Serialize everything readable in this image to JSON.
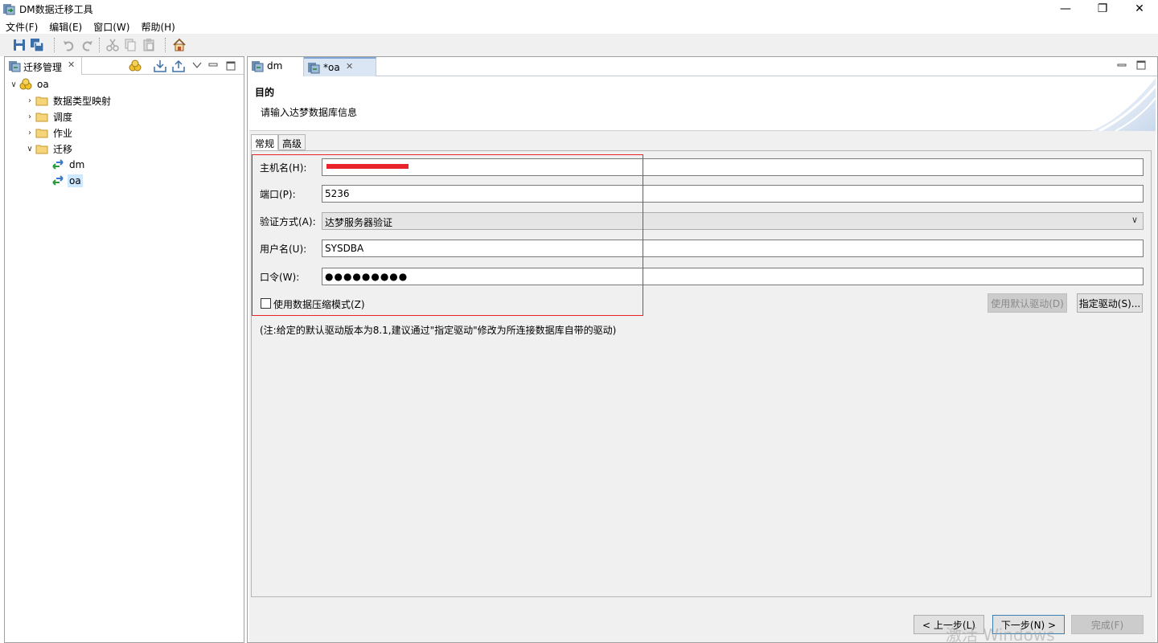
{
  "window": {
    "title": "DM数据迁移工具",
    "controls": {
      "minimize": "—",
      "maximize": "❐",
      "close": "✕"
    }
  },
  "menu": [
    {
      "label": "文件(F)"
    },
    {
      "label": "编辑(E)"
    },
    {
      "label": "窗口(W)"
    },
    {
      "label": "帮助(H)"
    }
  ],
  "left_view": {
    "tab_label": "迁移管理",
    "tree": {
      "root": "oa",
      "children": [
        "数据类型映射",
        "调度",
        "作业",
        "迁移"
      ],
      "migrations": [
        "dm",
        "oa"
      ]
    }
  },
  "editor": {
    "tabs": [
      {
        "label": "dm"
      },
      {
        "label": "*oa"
      }
    ],
    "wizard": {
      "title": "目的",
      "description": "请输入达梦数据库信息"
    },
    "subtabs": [
      "常规",
      "高级"
    ],
    "form": {
      "host_label": "主机名(H):",
      "port_label": "端口(P):",
      "port_value": "5236",
      "auth_label": "验证方式(A):",
      "auth_value": "达梦服务器验证",
      "user_label": "用户名(U):",
      "user_value": "SYSDBA",
      "password_label": "口令(W):",
      "password_value": "●●●●●●●●●",
      "compress_label": "使用数据压缩模式(Z)"
    },
    "buttons": {
      "default_driver": "使用默认驱动(D)",
      "specify_driver": "指定驱动(S)...",
      "prev": "< 上一步(L)",
      "next": "下一步(N) >",
      "finish": "完成(F)"
    },
    "note": "(注:给定的默认驱动版本为8.1,建议通过\"指定驱动\"修改为所连接数据库自带的驱动)"
  },
  "watermark": "激活 Windows",
  "colors": {
    "highlight": "#e8232a",
    "selection": "#cde8ff",
    "active_tab": "#dbe6f5"
  }
}
